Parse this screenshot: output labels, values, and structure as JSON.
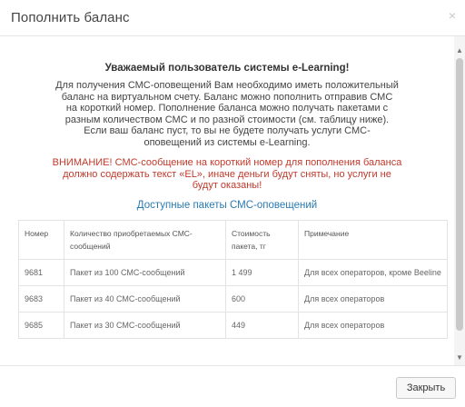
{
  "header": {
    "title": "Пополнить баланс",
    "close_icon": "×"
  },
  "body": {
    "greeting": "Уважаемый пользователь системы e-Learning!",
    "intro_lines": [
      "Для получения СМС-оповещений Вам необходимо иметь положительный",
      "баланс на виртуальном счету. Баланс можно пополнить отправив СМС",
      "на короткий номер. Пополнение баланса можно получать пакетами с",
      "разным количеством СМС и по разной стоимости (см. таблицу ниже).",
      "Если ваш баланс пуст, то вы не будете получать услуги СМС-",
      "оповещений из системы e-Learning."
    ],
    "warning_lines": [
      "ВНИМАНИЕ! СМС-сообщение на короткий номер для пополнения баланса",
      "должно содержать текст «EL», иначе деньги будут сняты, но услуги не",
      "будут оказаны!"
    ],
    "packages_title": "Доступные пакеты СМС-оповещений"
  },
  "table": {
    "headers": [
      "Номер",
      "Количество приобретаемых СМС-сообщений",
      "Стоимость пакета, тг",
      "Примечание"
    ],
    "rows": [
      [
        "9681",
        "Пакет из 100 СМС-сообщений",
        "1 499",
        "Для всех операторов, кроме Beeline"
      ],
      [
        "9683",
        "Пакет из 40 СМС-сообщений",
        "600",
        "Для всех операторов"
      ],
      [
        "9685",
        "Пакет из 30 СМС-сообщений",
        "449",
        "Для всех операторов"
      ]
    ]
  },
  "scrollbar": {
    "up_icon": "▲",
    "down_icon": "▼"
  },
  "footer": {
    "close_label": "Закрыть"
  }
}
